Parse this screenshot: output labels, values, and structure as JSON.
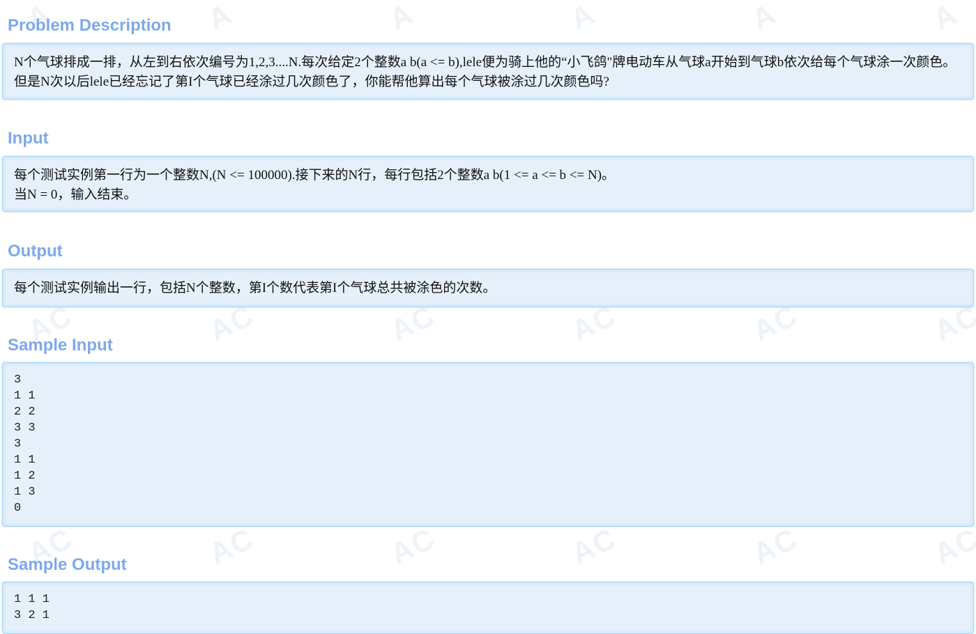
{
  "sections": {
    "description": {
      "title": "Problem Description",
      "text": "N个气球排成一排，从左到右依次编号为1,2,3....N.每次给定2个整数a b(a <= b),lele便为骑上他的“小飞鸽\"牌电动车从气球a开始到气球b依次给每个气球涂一次颜色。但是N次以后lele已经忘记了第I个气球已经涂过几次颜色了，你能帮他算出每个气球被涂过几次颜色吗?"
    },
    "input": {
      "title": "Input",
      "text": "每个测试实例第一行为一个整数N,(N <= 100000).接下来的N行，每行包括2个整数a b(1 <= a <= b <= N)。\n当N = 0，输入结束。"
    },
    "output": {
      "title": "Output",
      "text": "每个测试实例输出一行，包括N个整数，第I个数代表第I个气球总共被涂色的次数。"
    },
    "sample_input": {
      "title": "Sample Input",
      "text": "3\n1 1\n2 2\n3 3\n3\n1 1\n1 2\n1 3\n0"
    },
    "sample_output": {
      "title": "Sample Output",
      "text": "1 1 1\n3 2 1"
    }
  },
  "colors": {
    "title": "#7ca9ed",
    "panel_bg": "#e6f0fa",
    "panel_border": "#a9d4f2"
  }
}
